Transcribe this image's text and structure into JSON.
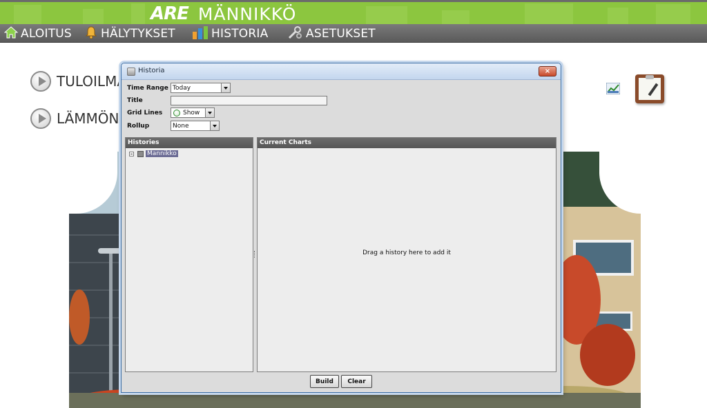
{
  "header": {
    "logo_text": "ARE",
    "site_name": "MÄNNIKKÖ"
  },
  "nav": [
    {
      "label": "ALOITUS",
      "icon": "home-icon"
    },
    {
      "label": "HÄLYTYKSET",
      "icon": "bell-icon"
    },
    {
      "label": "HISTORIA",
      "icon": "bar-chart-icon"
    },
    {
      "label": "ASETUKSET",
      "icon": "wrench-gear-icon"
    }
  ],
  "page_links": [
    {
      "label": "TULOILMA"
    },
    {
      "label": "LÄMMÖN"
    }
  ],
  "side_icons": [
    "chart-icon",
    "clipboard-icon"
  ],
  "dialog": {
    "title": "Historia",
    "close_label": "×",
    "fields": {
      "time_range": {
        "label": "Time Range",
        "value": "Today"
      },
      "title": {
        "label": "Title",
        "value": ""
      },
      "grid_lines": {
        "label": "Grid Lines",
        "value": "Show"
      },
      "rollup": {
        "label": "Rollup",
        "value": "None"
      }
    },
    "histories": {
      "header": "Histories",
      "items": [
        {
          "label": "Mannikko"
        }
      ]
    },
    "current_charts": {
      "header": "Current Charts",
      "placeholder": "Drag a history here to add it"
    },
    "buttons": {
      "build": "Build",
      "clear": "Clear"
    }
  },
  "colors": {
    "banner_green": "#8cc63f",
    "nav_gray": "#666666",
    "dialog_border": "#3c6ea5",
    "close_red": "#c84a2b"
  }
}
